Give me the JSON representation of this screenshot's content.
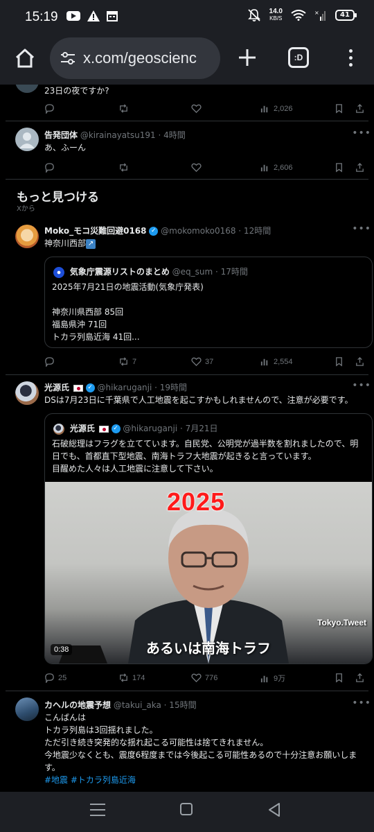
{
  "status_bar": {
    "time": "15:19",
    "net_speed_value": "14.0",
    "net_speed_unit": "KB/S",
    "battery": "41"
  },
  "browser": {
    "url": "x.com/geoscienc",
    "tabs_label": ":D"
  },
  "feed": {
    "partial_tweet": {
      "text": "23日の夜ですか?",
      "views": "2,026"
    },
    "reply_tweet": {
      "name": "告発団体",
      "handle": "@kirainayatsu191 · 4時間",
      "text": "あ、ふーん",
      "views": "2,606"
    },
    "section": {
      "title": "もっと見つける",
      "subtitle": "Xから"
    },
    "tweets": [
      {
        "name": "Moko_モコ災難回避0168",
        "handle": "@mokomoko0168 · 12時間",
        "text": "神奈川西部",
        "quote": {
          "name": "気象庁震源リストのまとめ",
          "handle": "@eq_sum · 17時間",
          "text": "2025年7月21日の地震活動(気象庁発表)\n\n神奈川県西部 85回\n福島県沖 71回\nトカラ列島近海 41回..."
        },
        "reposts": "7",
        "likes": "37",
        "views": "2,554"
      },
      {
        "name": "光源氏",
        "handle": "@hikaruganji · 19時間",
        "text": "DSは7月23日に千葉県で人工地震を起こすかもしれませんので、注意が必要です。",
        "quote": {
          "name": "光源氏",
          "handle": "@hikaruganji · 7月21日",
          "text": "石破総理はフラグを立てています。自民党、公明党が過半数を割れましたので、明日でも、首都直下型地震、南海トラフ大地震が起きると言っています。\n目醒めた人々は人工地震に注意して下さい。",
          "video": {
            "overlay_year": "2025",
            "channel": "Tokyo.Tweet",
            "caption": "あるいは南海トラフ",
            "duration": "0:38"
          }
        },
        "replies": "25",
        "reposts": "174",
        "likes": "776",
        "views": "9万"
      },
      {
        "name": "カヘルの地震予想",
        "handle": "@takui_aka · 15時間",
        "text": "こんばんは\nトカラ列島は3回揺れました。\nただ引き続き突発的な揺れ起こる可能性は捨てきれません。\n今地震少なくとも、震度6程度までは今後起こる可能性あるので十分注意お願いします。",
        "hashtags": "#地震 #トカラ列島近海"
      }
    ]
  },
  "colors": {
    "background": "#000000",
    "chrome": "#1d1f24",
    "muted_text": "#71767b",
    "link": "#1d9bf0",
    "divider": "#2f3336"
  }
}
